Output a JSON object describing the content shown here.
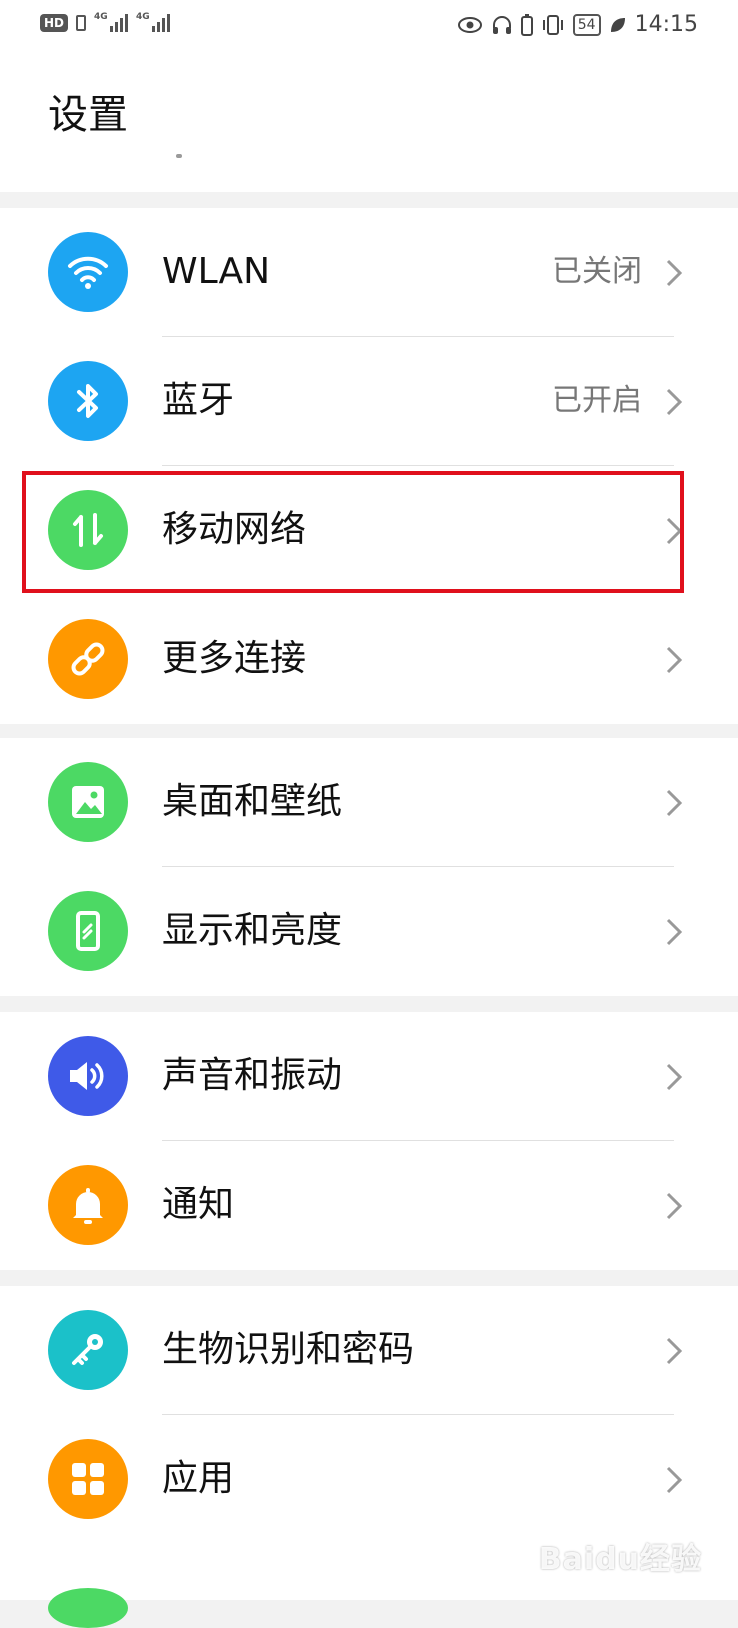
{
  "status_bar": {
    "hd_label": "HD",
    "sim1_network": "4G",
    "sim2_network": "4G",
    "battery_level": "54",
    "time": "14:15"
  },
  "header": {
    "title": "设置"
  },
  "groups": [
    {
      "items": [
        {
          "label": "WLAN",
          "value": "已关闭",
          "icon": "wifi-icon",
          "icon_color": "#1da5f2"
        },
        {
          "label": "蓝牙",
          "value": "已开启",
          "icon": "bluetooth-icon",
          "icon_color": "#1da5f2"
        },
        {
          "label": "移动网络",
          "value": "",
          "icon": "mobile-data-icon",
          "icon_color": "#4cd964"
        },
        {
          "label": "更多连接",
          "value": "",
          "icon": "link-icon",
          "icon_color": "#ff9800"
        }
      ]
    },
    {
      "items": [
        {
          "label": "桌面和壁纸",
          "icon": "wallpaper-icon",
          "icon_color": "#4cd964"
        },
        {
          "label": "显示和亮度",
          "icon": "display-icon",
          "icon_color": "#4cd964"
        }
      ]
    },
    {
      "items": [
        {
          "label": "声音和振动",
          "icon": "sound-icon",
          "icon_color": "#3f5ae8"
        },
        {
          "label": "通知",
          "icon": "bell-icon",
          "icon_color": "#ff9800"
        }
      ]
    },
    {
      "items": [
        {
          "label": "生物识别和密码",
          "icon": "key-icon",
          "icon_color": "#1bc1c9"
        },
        {
          "label": "应用",
          "icon": "apps-icon",
          "icon_color": "#ff9800"
        }
      ]
    }
  ],
  "highlight_color": "#e0101c",
  "watermark": "Baidu经验"
}
